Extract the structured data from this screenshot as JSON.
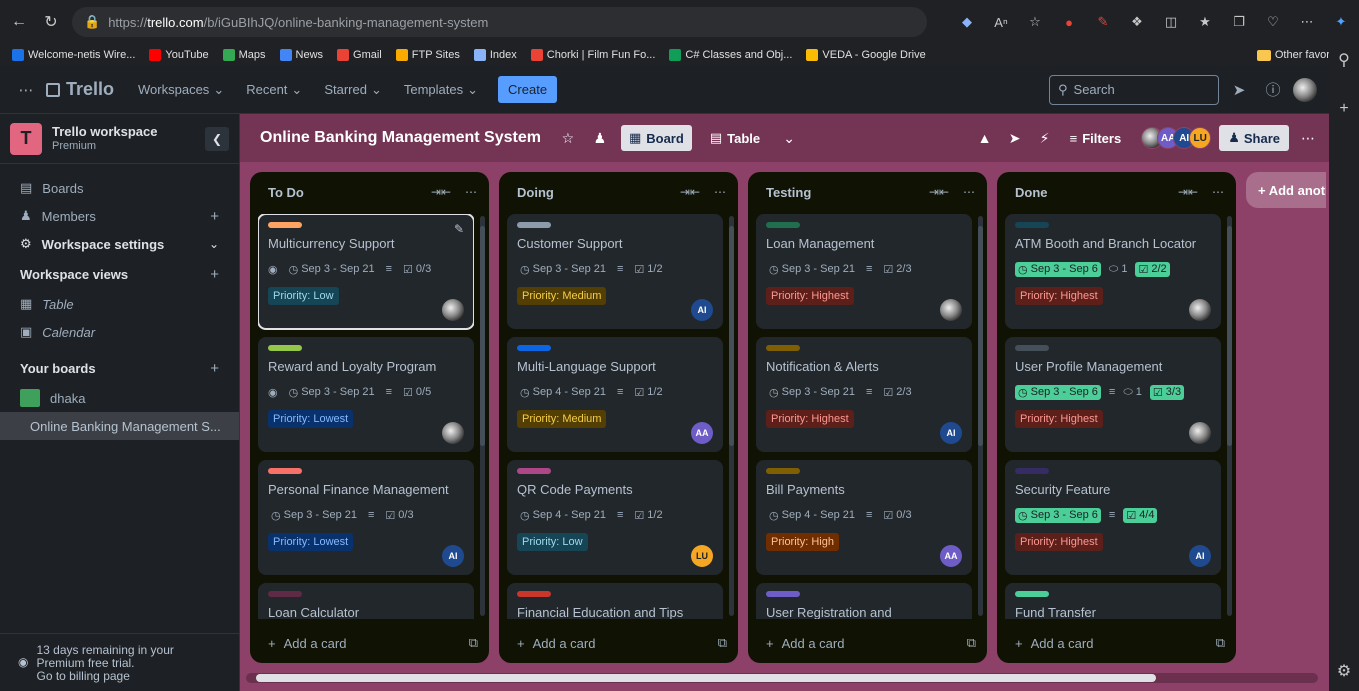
{
  "browser": {
    "url_prefix": "https://",
    "url_domain": "trello.com",
    "url_path": "/b/iGuBIhJQ/online-banking-management-system",
    "bookmarks": [
      {
        "label": "Welcome-netis Wire...",
        "color": "#1a73e8"
      },
      {
        "label": "YouTube",
        "color": "#ff0000"
      },
      {
        "label": "Maps",
        "color": "#34a853"
      },
      {
        "label": "News",
        "color": "#4285f4"
      },
      {
        "label": "Gmail",
        "color": "#ea4335"
      },
      {
        "label": "FTP Sites",
        "color": "#f9ab00"
      },
      {
        "label": "Index",
        "color": "#8ab4f8"
      },
      {
        "label": "Chorki | Film Fun Fo...",
        "color": "#ea4335"
      },
      {
        "label": "C# Classes and Obj...",
        "color": "#0f9d58"
      },
      {
        "label": "VEDA - Google Drive",
        "color": "#fbbc04"
      }
    ],
    "other_favorites": "Other favorites"
  },
  "header": {
    "logo": "Trello",
    "menus": [
      "Workspaces",
      "Recent",
      "Starred",
      "Templates"
    ],
    "create": "Create",
    "search_placeholder": "Search"
  },
  "sidebar": {
    "workspace_initial": "T",
    "workspace_name": "Trello workspace",
    "workspace_plan": "Premium",
    "boards": "Boards",
    "members": "Members",
    "workspace_settings": "Workspace settings",
    "workspace_views": "Workspace views",
    "table": "Table",
    "calendar": "Calendar",
    "your_boards": "Your boards",
    "board_items": [
      {
        "label": "dhaka",
        "color": "#3fa05b"
      },
      {
        "label": "Online Banking Management S...",
        "color": "#c2588a"
      }
    ],
    "trial_line1": "13 days remaining in your",
    "trial_line2": "Premium free trial.",
    "trial_line3": "Go to billing page"
  },
  "board": {
    "title": "Online Banking Management System",
    "view_board": "Board",
    "view_table": "Table",
    "filters": "Filters",
    "share": "Share",
    "members": [
      {
        "initials": "AA",
        "color": "#6e5dc6",
        "fg": "#fff"
      },
      {
        "initials": "AI",
        "color": "#1f4a8f",
        "fg": "#fff"
      },
      {
        "initials": "LU",
        "color": "#f5a623",
        "fg": "#1d2125"
      }
    ],
    "add_list": "+ Add another list",
    "add_card": "Add a card"
  },
  "lists": [
    {
      "title": "To Do",
      "cards": [
        {
          "cover": "#fea362",
          "title": "Multicurrency Support",
          "watch": true,
          "date": "Sep 3 - Sep 21",
          "date_done": false,
          "desc": true,
          "comments": "",
          "check": "0/3",
          "check_done": false,
          "label": "Priority: Low",
          "label_bg": "#164555",
          "label_fg": "#9dd9ee",
          "member": "photo",
          "selected": true
        },
        {
          "cover": "#94c748",
          "title": "Reward and Loyalty Program",
          "watch": true,
          "date": "Sep 3 - Sep 21",
          "date_done": false,
          "desc": true,
          "comments": "",
          "check": "0/5",
          "check_done": false,
          "label": "Priority: Lowest",
          "label_bg": "#09326c",
          "label_fg": "#85b8ff",
          "member": "photo"
        },
        {
          "cover": "#f87168",
          "title": "Personal Finance Management",
          "watch": false,
          "date": "Sep 3 - Sep 21",
          "date_done": false,
          "desc": true,
          "comments": "",
          "check": "0/3",
          "check_done": false,
          "label": "Priority: Lowest",
          "label_bg": "#09326c",
          "label_fg": "#85b8ff",
          "member": "AI"
        },
        {
          "cover": "#5e2a45",
          "title": "Loan Calculator"
        }
      ]
    },
    {
      "title": "Doing",
      "cards": [
        {
          "cover": "#8c9bab",
          "title": "Customer Support",
          "watch": false,
          "date": "Sep 3 - Sep 21",
          "date_done": false,
          "desc": true,
          "comments": "",
          "check": "1/2",
          "check_done": false,
          "label": "Priority: Medium",
          "label_bg": "#533f04",
          "label_fg": "#f5cd47",
          "member": "AI"
        },
        {
          "cover": "#0c66e4",
          "title": "Multi-Language Support",
          "watch": false,
          "date": "Sep 4 - Sep 21",
          "date_done": false,
          "desc": true,
          "comments": "",
          "check": "1/2",
          "check_done": false,
          "label": "Priority: Medium",
          "label_bg": "#533f04",
          "label_fg": "#f5cd47",
          "member": "AA"
        },
        {
          "cover": "#ae4787",
          "title": "QR Code Payments",
          "watch": false,
          "date": "Sep 4 - Sep 21",
          "date_done": false,
          "desc": true,
          "comments": "",
          "check": "1/2",
          "check_done": false,
          "label": "Priority: Low",
          "label_bg": "#164555",
          "label_fg": "#9dd9ee",
          "member": "LU"
        },
        {
          "cover": "#c9372c",
          "title": "Financial Education and Tips"
        }
      ]
    },
    {
      "title": "Testing",
      "cards": [
        {
          "cover": "#216e4e",
          "title": "Loan Management",
          "watch": false,
          "date": "Sep 3 - Sep 21",
          "date_done": false,
          "desc": true,
          "comments": "",
          "check": "2/3",
          "check_done": false,
          "label": "Priority: Highest",
          "label_bg": "#5d1f1a",
          "label_fg": "#fd9891",
          "member": "photo"
        },
        {
          "cover": "#7f5f01",
          "title": "Notification & Alerts",
          "watch": false,
          "date": "Sep 3 - Sep 21",
          "date_done": false,
          "desc": true,
          "comments": "",
          "check": "2/3",
          "check_done": false,
          "label": "Priority: Highest",
          "label_bg": "#5d1f1a",
          "label_fg": "#fd9891",
          "member": "AI"
        },
        {
          "cover": "#7f5f01",
          "title": "Bill Payments",
          "watch": false,
          "date": "Sep 4 - Sep 21",
          "date_done": false,
          "desc": true,
          "comments": "",
          "check": "0/3",
          "check_done": false,
          "label": "Priority: High",
          "label_bg": "#702e00",
          "label_fg": "#fec195",
          "member": "AA"
        },
        {
          "cover": "#6e5dc6",
          "title": "User Registration and"
        }
      ]
    },
    {
      "title": "Done",
      "cards": [
        {
          "cover": "#164555",
          "title": "ATM Booth and Branch Locator",
          "watch": false,
          "date": "Sep 3 - Sep 6",
          "date_done": true,
          "desc": false,
          "comments": "1",
          "check": "2/2",
          "check_done": true,
          "label": "Priority: Highest",
          "label_bg": "#5d1f1a",
          "label_fg": "#fd9891",
          "member": "photo"
        },
        {
          "cover": "#454f59",
          "title": "User Profile Management",
          "watch": false,
          "date": "Sep 3 - Sep 6",
          "date_done": true,
          "desc": true,
          "comments": "1",
          "check": "3/3",
          "check_done": true,
          "label": "Priority: Highest",
          "label_bg": "#5d1f1a",
          "label_fg": "#fd9891",
          "member": "photo"
        },
        {
          "cover": "#352c63",
          "title": "Security Feature",
          "watch": false,
          "date": "Sep 3 - Sep 6",
          "date_done": true,
          "desc": true,
          "comments": "",
          "check": "4/4",
          "check_done": true,
          "label": "Priority: Highest",
          "label_bg": "#5d1f1a",
          "label_fg": "#fd9891",
          "member": "AI"
        },
        {
          "cover": "#4bce97",
          "title": "Fund Transfer"
        }
      ]
    }
  ]
}
